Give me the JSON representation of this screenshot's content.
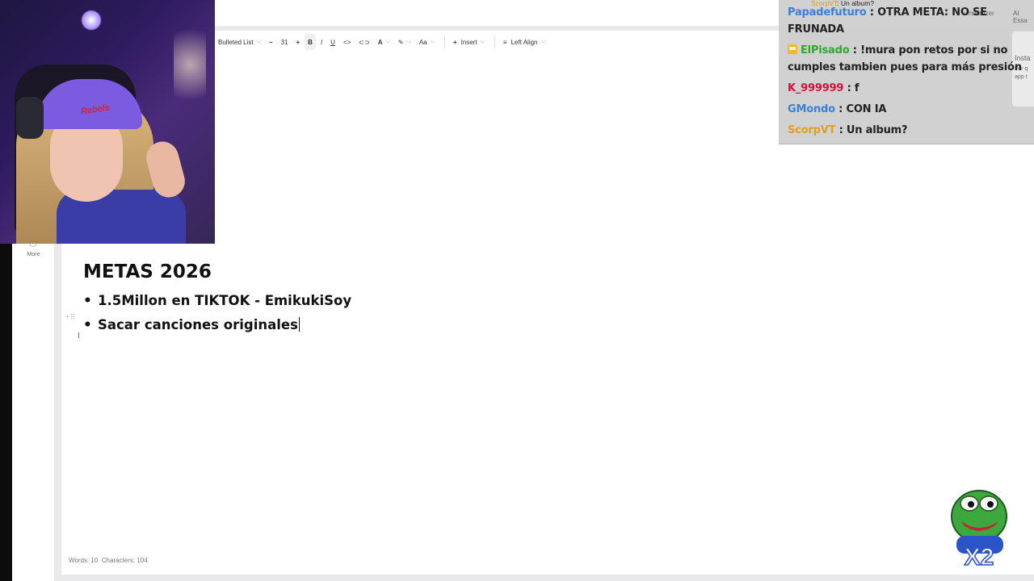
{
  "toolbar": {
    "list_label": "Bulleted List",
    "font_size": "31",
    "minus": "−",
    "plus": "+",
    "bold": "B",
    "italic": "I",
    "underline": "U",
    "code": "<>",
    "link": "⊂⊃",
    "text_color": "A",
    "highlight": "✎",
    "case": "Aa",
    "insert_label": "Insert",
    "insert_plus": "+",
    "align_label": "Left Align",
    "align_icon": "≡"
  },
  "sidebar": {
    "more_label": "More"
  },
  "document": {
    "title": "METAS 2026",
    "items": [
      "1.5Millon en TIKTOK - EmikukiSoy",
      "Sacar canciones originales"
    ]
  },
  "status": {
    "words_label": "Words: 10",
    "chars_label": "Characters: 104"
  },
  "chat": {
    "bg_labels": [
      "ummarizer",
      "AI Essa",
      "Insta",
      "For q",
      "app t"
    ],
    "ghost_user": "ScorpVT",
    "ghost_text": ": Un album?",
    "messages": [
      {
        "user": "Papadefuturo",
        "color": "#3d7fd6",
        "text": " : OTRA META: NO SE FRUNADA",
        "badge": false
      },
      {
        "user": "ElPisado",
        "color": "#2fa82f",
        "text": " : !mura pon retos por si no cumples tambien pues para más presión",
        "badge": true
      },
      {
        "user": "K_999999",
        "color": "#d2143a",
        "text": " : f",
        "badge": false
      },
      {
        "user": "GMondo",
        "color": "#3d7fd6",
        "text": " : CON IA",
        "badge": false
      },
      {
        "user": "ScorpVT",
        "color": "#e0a020",
        "text": " : Un album?",
        "badge": false
      }
    ]
  },
  "webcam": {
    "cap_text": "Rebels"
  },
  "emote": {
    "label": "X2",
    "icon": "pepe-emote-icon"
  },
  "colors": {
    "chat_bg": "#cdcdcd",
    "editor_bg": "#ffffff",
    "accent": "#3d7fd6"
  }
}
